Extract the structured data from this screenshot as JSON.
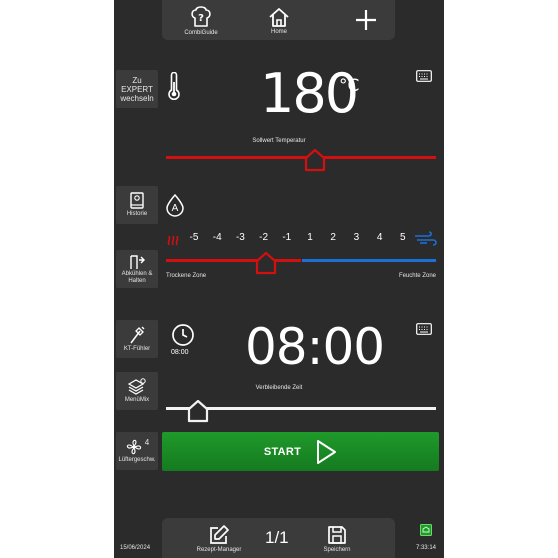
{
  "nav": {
    "combiguide_label": "CombiGuide",
    "home_label": "Home"
  },
  "sidebar": {
    "expert_label": "Zu EXPERT wechseln",
    "historie_label": "Historie",
    "abkuehlen_label": "Abkühlen & Halten",
    "kt_label": "KT-Fühler",
    "menumix_label": "MenüMix",
    "luefter_label": "Lüftergeschw.",
    "luefter_value": "4"
  },
  "temperature": {
    "value": "180",
    "unit": "°C",
    "caption": "Sollwert Temperatur",
    "slider_fraction": 0.55
  },
  "humidity": {
    "badge": "A",
    "scale": [
      "-5",
      "-4",
      "-3",
      "-2",
      "-1",
      "1",
      "2",
      "3",
      "4",
      "5"
    ],
    "selected": "-2",
    "dry_label": "Trockene Zone",
    "wet_label": "Feuchte Zone"
  },
  "time": {
    "small_value": "08:00",
    "value": "08:00",
    "caption": "Verbleibende Zeit",
    "slider_fraction": 0.12
  },
  "start_label": "START",
  "footer": {
    "date": "15/06/2024",
    "time": "7:33:14",
    "rezept_label": "Rezept-Manager",
    "page": "1/1",
    "speichern_label": "Speichern"
  },
  "colors": {
    "accent_red": "#d21010",
    "accent_blue": "#1c6fd6",
    "start_green": "#1f9a2a",
    "panel": "#2b2b2b"
  }
}
